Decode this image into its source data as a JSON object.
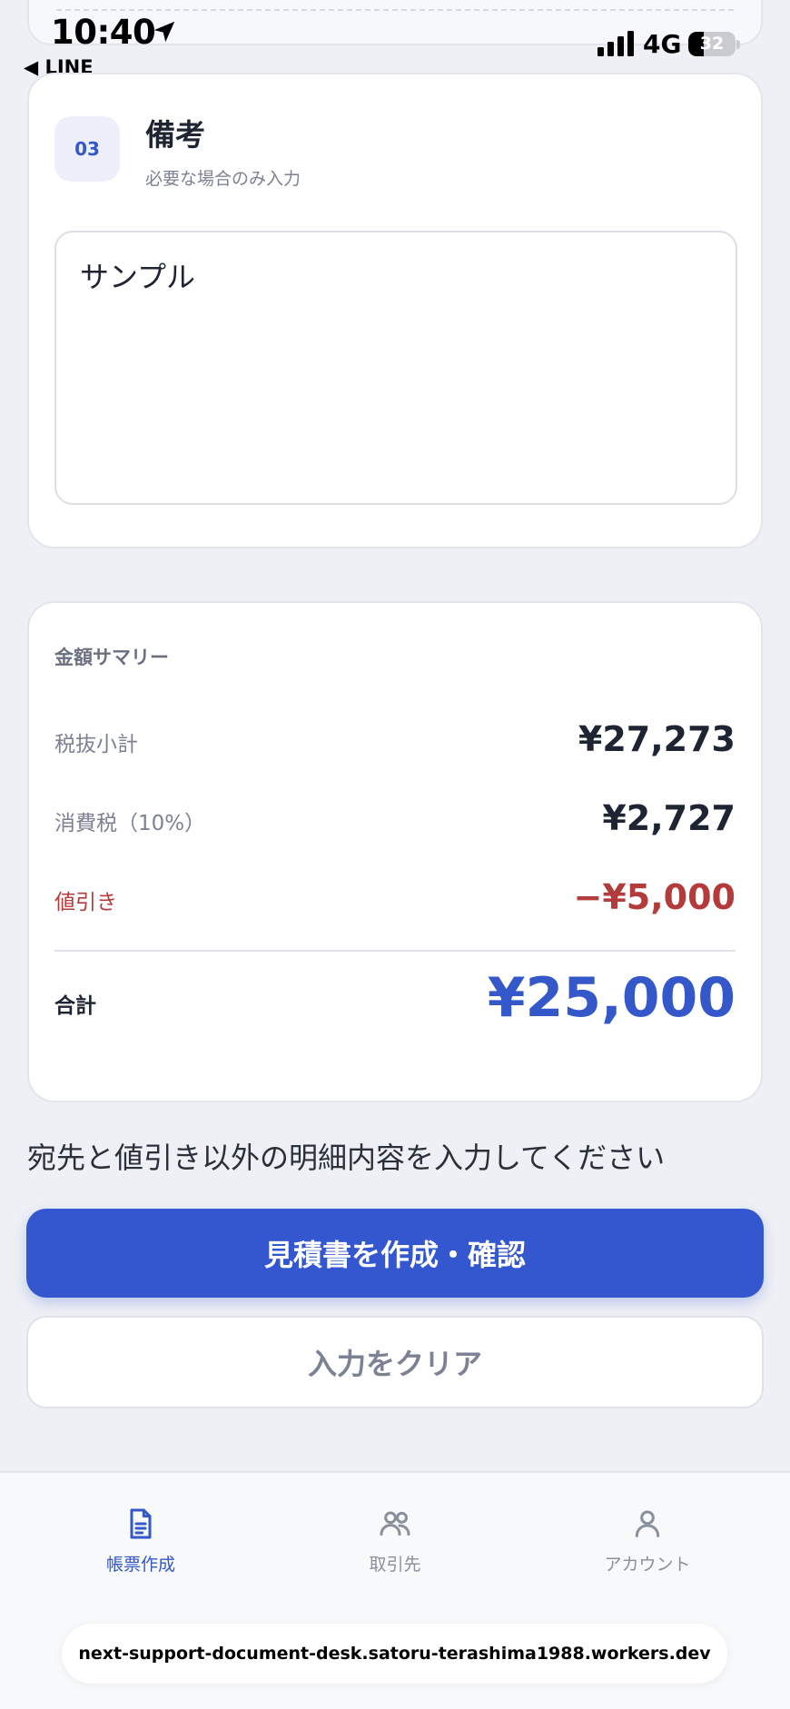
{
  "status_bar": {
    "time": "10:40",
    "back_app": "◀ LINE",
    "network": "4G",
    "battery": "32",
    "battery_level": 0.32
  },
  "notes": {
    "step": "03",
    "title": "備考",
    "subtitle": "必要な場合のみ入力",
    "value": "サンプル"
  },
  "summary": {
    "heading": "金額サマリー",
    "subtotal_label": "税抜小計",
    "subtotal_value": "¥27,273",
    "tax_label": "消費税（10%）",
    "tax_value": "¥2,727",
    "discount_label": "値引き",
    "discount_value": "−¥5,000",
    "total_label": "合計",
    "total_value": "¥25,000"
  },
  "helper_text": "宛先と値引き以外の明細内容を入力してください",
  "actions": {
    "primary_label": "見積書を作成・確認",
    "secondary_label": "入力をクリア"
  },
  "tabbar": {
    "items": [
      {
        "label": "帳票作成",
        "icon": "document-icon",
        "active": true
      },
      {
        "label": "取引先",
        "icon": "people-icon",
        "active": false
      },
      {
        "label": "アカウント",
        "icon": "person-icon",
        "active": false
      }
    ]
  },
  "browser": {
    "url": "next-support-document-desk.satoru-terashima1988.workers.dev"
  },
  "colors": {
    "accent": "#3457cf",
    "discount": "#b33b3b",
    "background": "#eef0f5"
  }
}
